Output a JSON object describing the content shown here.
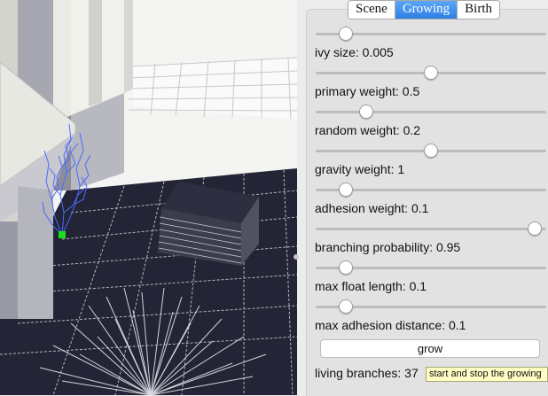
{
  "tabs": [
    {
      "label": "Scene",
      "active": false
    },
    {
      "label": "Growing",
      "active": true
    },
    {
      "label": "Birth",
      "active": false
    }
  ],
  "params": [
    {
      "label": "ivy size: 0.005",
      "slider_fraction": 0.13
    },
    {
      "label": "primary weight: 0.5",
      "slider_fraction": 0.5
    },
    {
      "label": "random weight: 0.2",
      "slider_fraction": 0.22
    },
    {
      "label": "gravity weight: 1",
      "slider_fraction": 0.5
    },
    {
      "label": "adhesion weight: 0.1",
      "slider_fraction": 0.13
    },
    {
      "label": "branching probability: 0.95",
      "slider_fraction": 0.95
    },
    {
      "label": "max float length: 0.1",
      "slider_fraction": 0.13
    },
    {
      "label": "max adhesion distance: 0.1",
      "slider_fraction": 0.13
    }
  ],
  "grow_button": {
    "label": "grow"
  },
  "status": {
    "living_branches": "living branches: 37"
  },
  "tooltip": {
    "text": "start and stop the growing"
  },
  "colors": {
    "accent": "#2f7fe6",
    "ivy": "#4a6cff",
    "seed": "#19e019"
  }
}
